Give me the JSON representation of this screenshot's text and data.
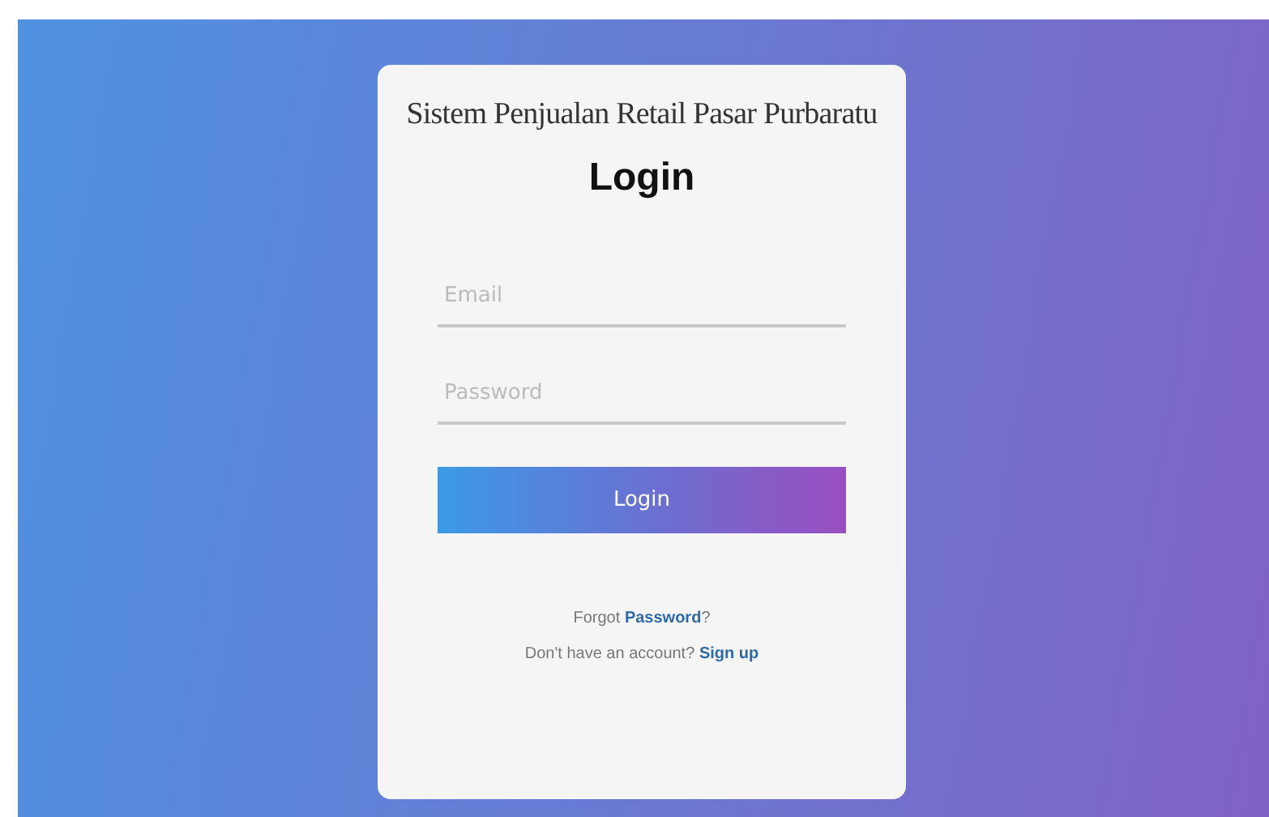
{
  "app_title": "Sistem Penjualan Retail Pasar Purbaratu",
  "heading": "Login",
  "email_field": {
    "placeholder": "Email"
  },
  "password_field": {
    "placeholder": "Password"
  },
  "submit": "Login",
  "forgot": {
    "before": "Forgot ",
    "link": "Password",
    "after": "?"
  },
  "signup": {
    "before": "Don't have an account? ",
    "link": "Sign up"
  }
}
